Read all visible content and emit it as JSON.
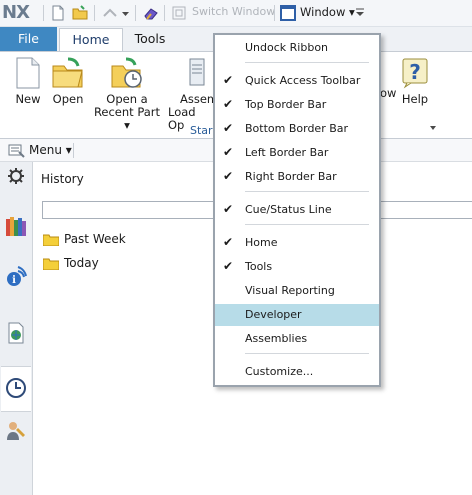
{
  "app": {
    "logo": "NX"
  },
  "qat": {
    "switch_window": "Switch Window",
    "window": "Window",
    "window_caret": "▾"
  },
  "tabs": [
    {
      "label": "File"
    },
    {
      "label": "Home"
    },
    {
      "label": "Tools"
    }
  ],
  "ribbon": {
    "new": "New",
    "open": "Open",
    "recent_line1": "Open a",
    "recent_line2": "Recent Part ▾",
    "assem_line1": "Assem",
    "assem_line2": "Load Op",
    "group_label": "Star",
    "view_partial": "ow",
    "help": "Help"
  },
  "command_bar": {
    "menu": "Menu ▾"
  },
  "history": {
    "title": "History",
    "search_value": "",
    "items": [
      {
        "label": "Past Week"
      },
      {
        "label": "Today"
      }
    ]
  },
  "dropdown": {
    "items": [
      {
        "label": "Undock Ribbon",
        "checked": false
      },
      {
        "label": "Quick Access Toolbar",
        "checked": true
      },
      {
        "label": "Top Border Bar",
        "checked": true
      },
      {
        "label": "Bottom Border Bar",
        "checked": true
      },
      {
        "label": "Left Border Bar",
        "checked": true
      },
      {
        "label": "Right Border Bar",
        "checked": true
      },
      {
        "label": "Cue/Status Line",
        "checked": true
      },
      {
        "label": "Home",
        "checked": true
      },
      {
        "label": "Tools",
        "checked": true
      },
      {
        "label": "Visual Reporting",
        "checked": false
      },
      {
        "label": "Developer",
        "checked": false,
        "highlighted": true
      },
      {
        "label": "Assemblies",
        "checked": false
      },
      {
        "label": "Customize...",
        "checked": false
      }
    ],
    "check_glyph": "✔"
  },
  "colors": {
    "file_tab": "#3f88c2",
    "highlight": "#b7dce8",
    "group_label": "#2a5d99"
  }
}
